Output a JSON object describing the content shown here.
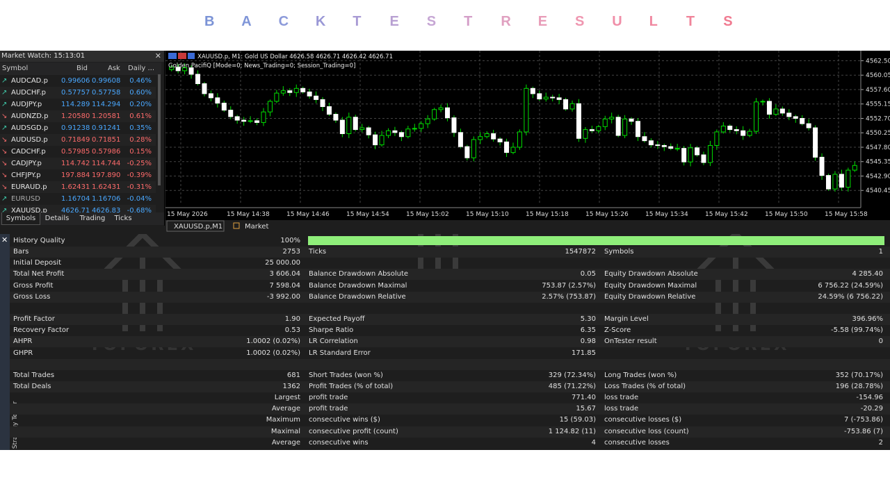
{
  "title_letters": [
    "B",
    "A",
    "C",
    "K",
    "T",
    "E",
    "S",
    "T",
    "R",
    "E",
    "S",
    "U",
    "L",
    "T",
    "S"
  ],
  "title_colors": [
    "#7b93d6",
    "#8096d8",
    "#8c9ada",
    "#9a98d6",
    "#a89ad4",
    "#b8a0d2",
    "#c6a6d4",
    "#d49ec8",
    "#e0a0c0",
    "#e89cb8",
    "#ef96b0",
    "#f08ea8",
    "#f088a0",
    "#f0849a",
    "#f07a90"
  ],
  "market_watch": {
    "title": "Market Watch: 15:13:01",
    "close": "✕",
    "cols": {
      "symbol": "Symbol",
      "bid": "Bid",
      "ask": "Ask",
      "daily": "Daily ..."
    },
    "rows": [
      {
        "symbol": "AUDCAD.p",
        "bid": "0.99606",
        "ask": "0.99608",
        "daily": "0.46%",
        "dir": "up"
      },
      {
        "symbol": "AUDCHF.p",
        "bid": "0.57757",
        "ask": "0.57758",
        "daily": "0.60%",
        "dir": "up"
      },
      {
        "symbol": "AUDJPY.p",
        "bid": "114.289",
        "ask": "114.294",
        "daily": "0.20%",
        "dir": "up"
      },
      {
        "symbol": "AUDNZD.p",
        "bid": "1.20580",
        "ask": "1.20581",
        "daily": "0.61%",
        "dir": "down"
      },
      {
        "symbol": "AUDSGD.p",
        "bid": "0.91238",
        "ask": "0.91241",
        "daily": "0.35%",
        "dir": "up"
      },
      {
        "symbol": "AUDUSD.p",
        "bid": "0.71849",
        "ask": "0.71851",
        "daily": "0.28%",
        "dir": "down"
      },
      {
        "symbol": "CADCHF.p",
        "bid": "0.57985",
        "ask": "0.57986",
        "daily": "0.15%",
        "dir": "down"
      },
      {
        "symbol": "CADJPY.p",
        "bid": "114.742",
        "ask": "114.744",
        "daily": "-0.25%",
        "dir": "down"
      },
      {
        "symbol": "CHFJPY.p",
        "bid": "197.884",
        "ask": "197.890",
        "daily": "-0.39%",
        "dir": "down"
      },
      {
        "symbol": "EURAUD.p",
        "bid": "1.62431",
        "ask": "1.62431",
        "daily": "-0.31%",
        "dir": "down"
      },
      {
        "symbol": "EURUSD",
        "bid": "1.16704",
        "ask": "1.16706",
        "daily": "-0.04%",
        "dir": "up"
      },
      {
        "symbol": "XAUUSD.p",
        "bid": "4626.71",
        "ask": "4626.83",
        "daily": "-0.68%",
        "dir": "up"
      }
    ],
    "tabs": [
      "Symbols",
      "Details",
      "Trading",
      "Ticks"
    ]
  },
  "chart": {
    "header": "XAUUSD.p, M1:  Gold US Dollar  4626.58 4626.71 4626.42 4626.71",
    "ea": "Golden PacifiQ [Mode=0; News_Trading=0; Session_Trading=0]",
    "y_ticks": [
      "4562.50",
      "4560.05",
      "4557.60",
      "4555.15",
      "4552.70",
      "4550.25",
      "4547.80",
      "4545.35",
      "4542.90",
      "4540.45"
    ],
    "y_range": [
      4538.0,
      4563.5
    ],
    "x_ticks": [
      "15 May 2026",
      "15 May 14:38",
      "15 May 14:46",
      "15 May 14:54",
      "15 May 15:02",
      "15 May 15:10",
      "15 May 15:18",
      "15 May 15:26",
      "15 May 15:34",
      "15 May 15:42",
      "15 May 15:50",
      "15 May 15:58"
    ],
    "closes": [
      4561.4,
      4560.8,
      4561.3,
      4560.2,
      4558.6,
      4556.9,
      4556.2,
      4555.3,
      4554.1,
      4553.0,
      4552.4,
      4552.2,
      4552.3,
      4552.0,
      4553.8,
      4555.6,
      4557.0,
      4557.4,
      4557.1,
      4557.8,
      4557.2,
      4556.5,
      4555.9,
      4554.7,
      4553.4,
      4552.4,
      4550.1,
      4552.9,
      4550.8,
      4551.1,
      4549.9,
      4548.2,
      4549.8,
      4550.6,
      4550.3,
      4549.6,
      4550.9,
      4551.0,
      4551.8,
      4552.6,
      4554.2,
      4554.5,
      4552.8,
      4550.3,
      4547.9,
      4546.0,
      4549.1,
      4549.6,
      4550.1,
      4549.2,
      4548.7,
      4546.9,
      4547.8,
      4550.4,
      4557.8,
      4556.9,
      4556.0,
      4556.3,
      4556.2,
      4555.9,
      4554.3,
      4555.2,
      4549.3,
      4550.8,
      4550.6,
      4551.3,
      4552.6,
      4552.9,
      4549.8,
      4552.6,
      4552.2,
      4549.6,
      4548.9,
      4548.2,
      4548.1,
      4547.9,
      4547.6,
      4547.6,
      4545.3,
      4547.7,
      4546.5,
      4545.2,
      4548.1,
      4550.4,
      4551.4,
      4550.8,
      4550.6,
      4549.8,
      4550.5,
      4555.5,
      4555.6,
      4553.4,
      4554.3,
      4553.6,
      4553.0,
      4552.7,
      4551.8,
      4551.1,
      4546.1,
      4543.0,
      4540.7,
      4543.2,
      4541.0,
      4543.9,
      4544.7
    ],
    "tabs": [
      "XAUUSD.p,M1",
      "Market"
    ]
  },
  "tester": {
    "side_label": "Strategy Tester",
    "close": "✕",
    "watermark": "YOFOREX",
    "quality_bar": 1.0,
    "rows": [
      [
        "History Quality",
        "100%",
        "",
        "",
        "",
        ""
      ],
      [
        "Bars",
        "2753",
        "Ticks",
        "1547872",
        "Symbols",
        "1"
      ],
      [
        "Initial Deposit",
        "25 000.00",
        "",
        "",
        "",
        ""
      ],
      [
        "Total Net Profit",
        "3 606.04",
        "Balance Drawdown Absolute",
        "0.05",
        "Equity Drawdown Absolute",
        "4 285.40"
      ],
      [
        "Gross Profit",
        "7 598.04",
        "Balance Drawdown Maximal",
        "753.87 (2.57%)",
        "Equity Drawdown Maximal",
        "6 756.22 (24.59%)"
      ],
      [
        "Gross Loss",
        "-3 992.00",
        "Balance Drawdown Relative",
        "2.57% (753.87)",
        "Equity Drawdown Relative",
        "24.59% (6 756.22)"
      ],
      [
        "",
        "",
        "",
        "",
        "",
        ""
      ],
      [
        "Profit Factor",
        "1.90",
        "Expected Payoff",
        "5.30",
        "Margin Level",
        "396.96%"
      ],
      [
        "Recovery Factor",
        "0.53",
        "Sharpe Ratio",
        "6.35",
        "Z-Score",
        "-5.58 (99.74%)"
      ],
      [
        "AHPR",
        "1.0002 (0.02%)",
        "LR Correlation",
        "0.98",
        "OnTester result",
        "0"
      ],
      [
        "GHPR",
        "1.0002 (0.02%)",
        "LR Standard Error",
        "171.85",
        "",
        ""
      ],
      [
        "",
        "",
        "",
        "",
        "",
        ""
      ],
      [
        "Total Trades",
        "681",
        "Short Trades (won %)",
        "329 (72.34%)",
        "Long Trades (won %)",
        "352 (70.17%)"
      ],
      [
        "Total Deals",
        "1362",
        "Profit Trades (% of total)",
        "485 (71.22%)",
        "Loss Trades (% of total)",
        "196 (28.78%)"
      ],
      [
        "",
        "Largest",
        "profit trade",
        "771.40",
        "loss trade",
        "-154.96"
      ],
      [
        "",
        "Average",
        "profit trade",
        "15.67",
        "loss trade",
        "-20.29"
      ],
      [
        "",
        "Maximum",
        "consecutive wins ($)",
        "15 (59.03)",
        "consecutive losses ($)",
        "7 (-753.86)"
      ],
      [
        "",
        "Maximal",
        "consecutive profit (count)",
        "1 124.82 (11)",
        "consecutive loss (count)",
        "-753.86 (7)"
      ],
      [
        "",
        "Average",
        "consecutive wins",
        "4",
        "consecutive losses",
        "2"
      ]
    ]
  },
  "colors": {
    "up": "#3fc8a8",
    "down": "#f06a6a",
    "bid": "#4aa8ff",
    "bid_down": "#ff6b6b",
    "grid": "#3a3a3a",
    "quality": "#8fee7a"
  }
}
